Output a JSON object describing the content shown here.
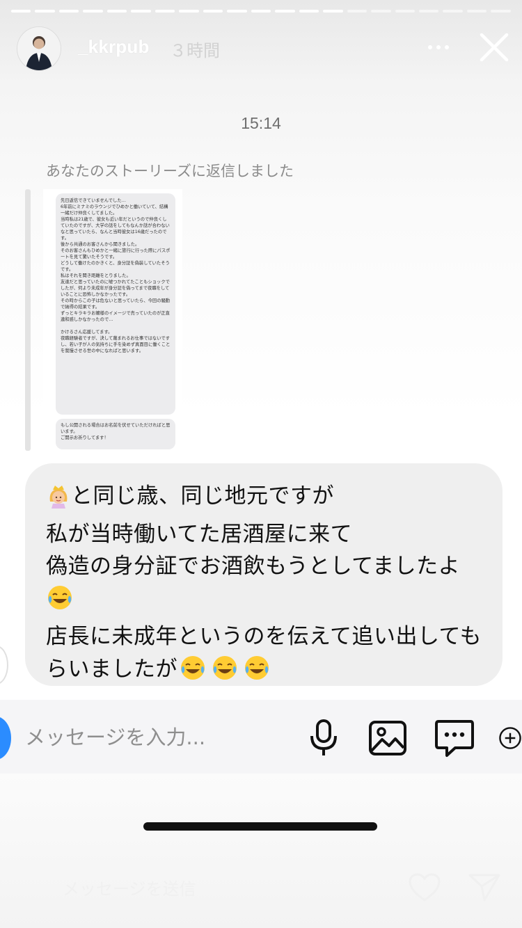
{
  "story": {
    "username": "_kkrpub",
    "time_ago": "３時間",
    "progress_segments": 21,
    "progress_done": 14
  },
  "chat": {
    "timestamp": "15:14",
    "reply_note": "あなたのストーリーズに返信しました",
    "quoted_message": {
      "bubble1": "先日返信できていませんでした…\n6年前にミナミのラウンジでひめかと働いていて、結構一緒だけ仲良くしてました。\n当時私は21歳で、彼女も近い年だというので仲良くしていたのですが、大学の話をしてもなんか話が合わないなと思っていたら、なんと当時彼女は16歳だったのです。\n後から共通のお客さんから聞きました。\nそのお客さんもひめかと一緒に旅行に行った際にパスポートを見て驚いたそうです。\nどうして働けたのかきくと、身分証を偽装していたそうです。\n私はそれを聞き距離をとりました。\n友達だと思っていたのに嘘つかれてたこともショックでしたが、何より未成年が身分証を偽ってまで夜職をしていることに恐怖しかなかったです。\nその時からこの子は危ないと思っていたら、今回の騒動で納得の結果です。\nずっとキラキラお嬢様のイメージで売っていたのが正直違和感しかなかったので…\n\nかけるさん応援してます。\n夜職経験者ですが、決して蔑まれるお仕事ではないですし、若い子が人の気持ちに手を染めず真面目に働くことを我慢させる世の中になればと思います。",
      "bubble2": "もし公開される場合はお名前を伏せていただければと思います。\nご開示お祈りしてます！"
    },
    "message_lines": [
      "と同じ歳、同じ地元ですが",
      "私が当時働いてた居酒屋に来て",
      "偽造の身分証でお酒飲もうとしてましたよ",
      "店長に未成年というのを伝えて追い出してもらいましたが"
    ],
    "emoji": {
      "princess": "princess-emoji",
      "laughing": "face-with-tears-of-joy"
    }
  },
  "composer": {
    "placeholder": "メッセージを入力..."
  },
  "footer": {
    "reply_placeholder": "メッセージを送信"
  },
  "colors": {
    "accent": "#2b8cff",
    "bubble": "#efefef",
    "text": "#111111"
  }
}
